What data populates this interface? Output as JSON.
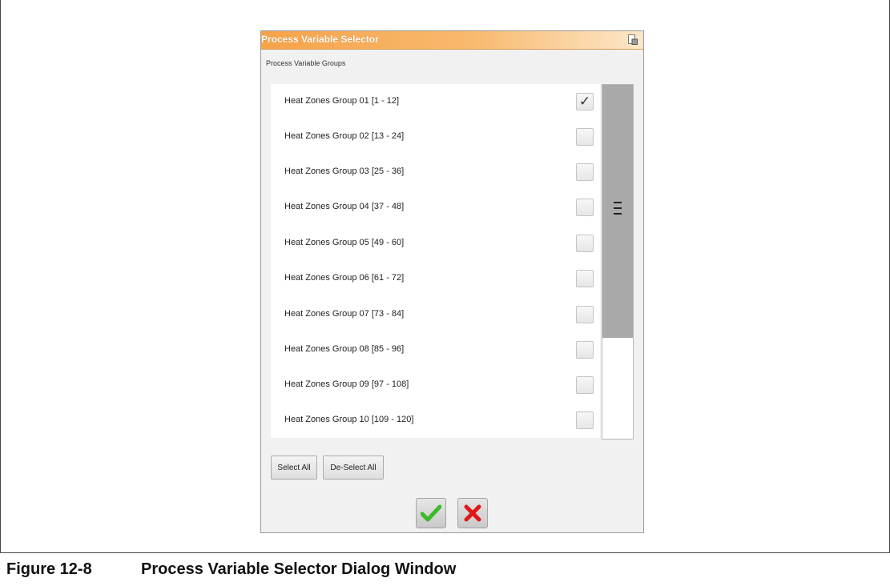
{
  "dialog": {
    "title": "Process Variable Selector",
    "groups_label": "Process Variable Groups",
    "select_all_label": "Select All",
    "deselect_all_label": "De-Select All",
    "items": [
      {
        "label": "Heat Zones Group 01 [1 - 12]",
        "checked": true,
        "check_glyph": "✓"
      },
      {
        "label": "Heat Zones Group 02 [13 - 24]",
        "checked": false,
        "check_glyph": ""
      },
      {
        "label": "Heat Zones Group 03 [25 - 36]",
        "checked": false,
        "check_glyph": ""
      },
      {
        "label": "Heat Zones Group 04 [37 - 48]",
        "checked": false,
        "check_glyph": ""
      },
      {
        "label": "Heat Zones Group 05 [49 - 60]",
        "checked": false,
        "check_glyph": ""
      },
      {
        "label": "Heat Zones Group 06 [61 - 72]",
        "checked": false,
        "check_glyph": ""
      },
      {
        "label": "Heat Zones Group 07 [73 - 84]",
        "checked": false,
        "check_glyph": ""
      },
      {
        "label": "Heat Zones Group 08 [85 - 96]",
        "checked": false,
        "check_glyph": ""
      },
      {
        "label": "Heat Zones Group 09 [97 - 108]",
        "checked": false,
        "check_glyph": ""
      },
      {
        "label": "Heat Zones Group 10 [109 - 120]",
        "checked": false,
        "check_glyph": ""
      }
    ],
    "colors": {
      "title_bar": "#f6a34a",
      "ok_check": "#3cba2c",
      "cancel_x": "#e01818"
    },
    "icons": {
      "ok": "checkmark-icon",
      "cancel": "x-icon",
      "window": "window-icon"
    }
  },
  "caption": {
    "number": "Figure 12-8",
    "text": "Process Variable Selector Dialog Window"
  }
}
